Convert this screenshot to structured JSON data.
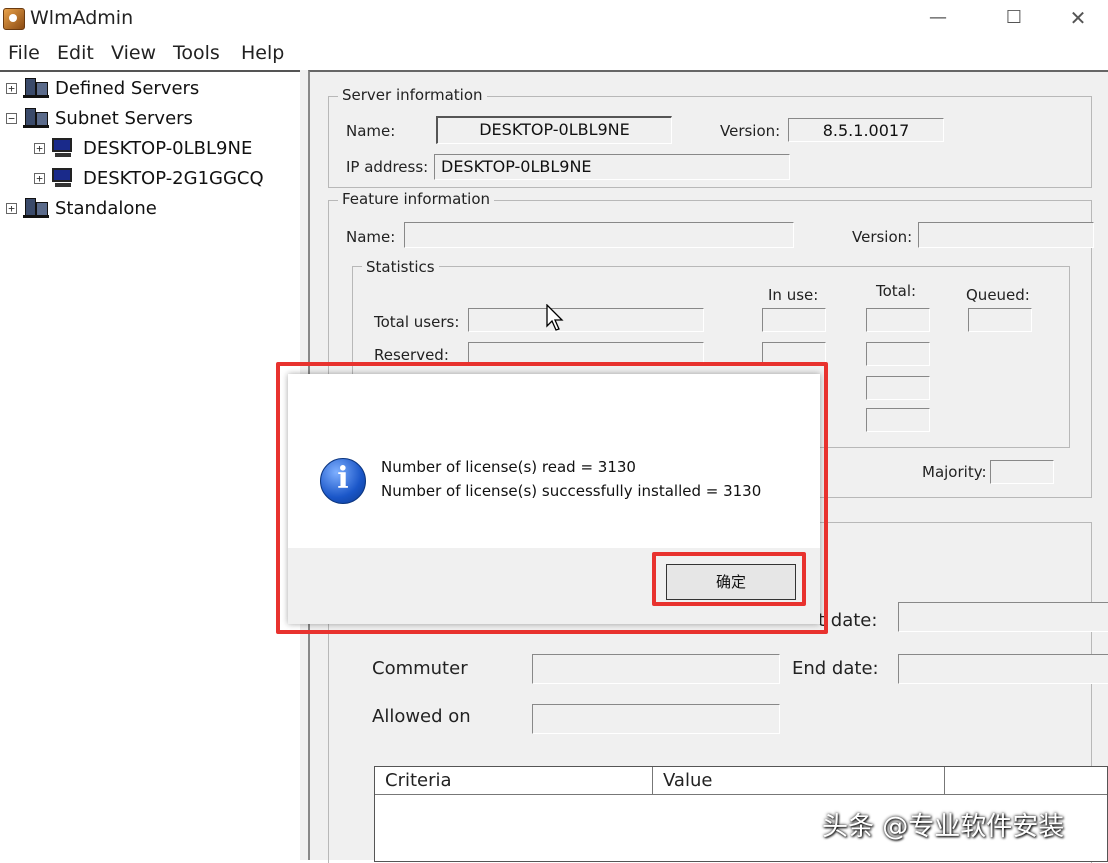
{
  "window": {
    "title": "WlmAdmin",
    "minimize_glyph": "—",
    "maximize_glyph": "☐",
    "close_glyph": "✕"
  },
  "menu": [
    "File",
    "Edit",
    "View",
    "Tools",
    "Help"
  ],
  "tree": {
    "expand_glyph": "+",
    "collapse_glyph": "−",
    "items": [
      {
        "label": "Defined Servers",
        "icon": "network-servers-icon",
        "expanded": false
      },
      {
        "label": "Subnet Servers",
        "icon": "network-servers-icon",
        "expanded": true
      },
      {
        "label": "DESKTOP-0LBL9NE",
        "icon": "computer-icon",
        "expanded": false
      },
      {
        "label": "DESKTOP-2G1GGCQ",
        "icon": "computer-icon",
        "expanded": false
      },
      {
        "label": "Standalone",
        "icon": "network-servers-icon",
        "expanded": false
      }
    ]
  },
  "server_info": {
    "legend": "Server information",
    "name_label": "Name:",
    "name_value": "DESKTOP-0LBL9NE",
    "version_label": "Version:",
    "version_value": "8.5.1.0017",
    "ip_label": "IP address:",
    "ip_value": "DESKTOP-0LBL9NE"
  },
  "feature_info": {
    "legend": "Feature information",
    "name_label": "Name:",
    "version_label": "Version:",
    "majority_label": "Majority:"
  },
  "statistics": {
    "legend": "Statistics",
    "in_use_header": "In use:",
    "total_header": "Total:",
    "queued_header": "Queued:",
    "total_users_label": "Total users:",
    "reserved_label": "Reserved:"
  },
  "license": {
    "start_date_label": "t date:",
    "commuter_label": "Commuter",
    "end_date_label": "End date:",
    "allowed_on_label": "Allowed on"
  },
  "table": {
    "columns": [
      "Criteria",
      "Value"
    ]
  },
  "dialog": {
    "icon": "info-icon",
    "info_glyph": "i",
    "line1": "Number of license(s) read = 3130",
    "line2": "Number of license(s) successfully installed = 3130",
    "ok_label": "确定"
  },
  "watermark": "头条 @专业软件安装",
  "highlight_color": "#e8322e"
}
